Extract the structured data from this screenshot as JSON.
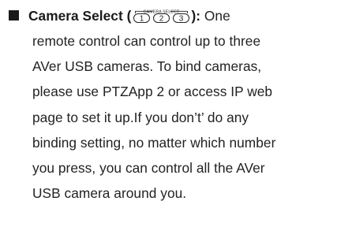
{
  "item": {
    "term": "Camera Select",
    "open_paren": "(",
    "close_colon": "):",
    "first_line_rest": " One",
    "button_group_caption": "CAMERA SELECT",
    "buttons": [
      "1",
      "2",
      "3"
    ],
    "lines": [
      "remote control can control up to three",
      "AVer USB cameras. To bind cameras,",
      "please use PTZApp 2 or access IP web",
      "page to set it up.If you don’t’ do any",
      "binding setting, no matter which number",
      "you press, you can control all the AVer",
      "USB camera around you."
    ]
  }
}
